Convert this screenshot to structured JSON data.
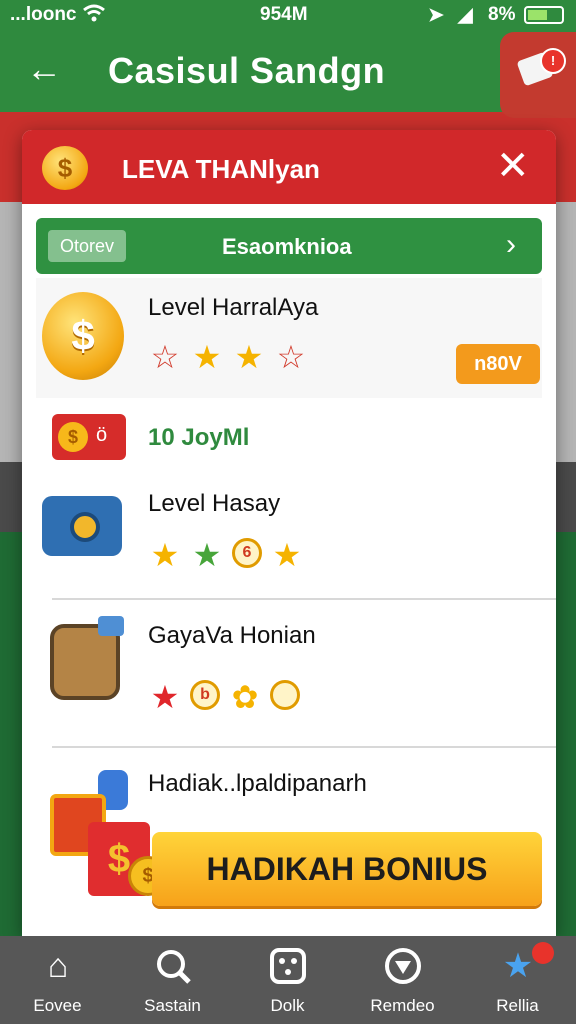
{
  "status_bar": {
    "carrier": "...loonc",
    "time": "954M",
    "battery_text": "8%",
    "battery_level": 0.6
  },
  "app_bar": {
    "title": "Casisul Sandgn",
    "notification_badge": "!"
  },
  "modal": {
    "title": "LEVA THANlyan",
    "filter": {
      "chip": "Otorev",
      "label": "Esaomknioa"
    },
    "items": [
      {
        "name": "Level HarralAya",
        "badge": "n80V",
        "stars": [
          "outline-star",
          "star",
          "star",
          "outline-star"
        ]
      },
      {
        "name": "Level Hasay",
        "stars": [
          "star",
          "green-star",
          "token",
          "star"
        ]
      },
      {
        "name": "GayaVa Honian",
        "stars": [
          "red-star",
          "token",
          "flower",
          "coin"
        ]
      },
      {
        "name": "Hadiak..lpaldipanarh"
      }
    ],
    "promo": {
      "text": "10 JoyMl"
    },
    "bonus_button": "HADIKAH BONIUS"
  },
  "bottom_nav": {
    "items": [
      {
        "label": "Eovee",
        "icon": "home-icon"
      },
      {
        "label": "Sastain",
        "icon": "search-icon"
      },
      {
        "label": "Dolk",
        "icon": "dice-icon"
      },
      {
        "label": "Remdeo",
        "icon": "pin-icon"
      },
      {
        "label": "Rellia",
        "icon": "star-icon"
      }
    ]
  },
  "colors": {
    "header_green": "#2f8a3e",
    "modal_red": "#d1282a",
    "bonus_orange": "#f7a21a",
    "nav_grey": "#575757"
  }
}
